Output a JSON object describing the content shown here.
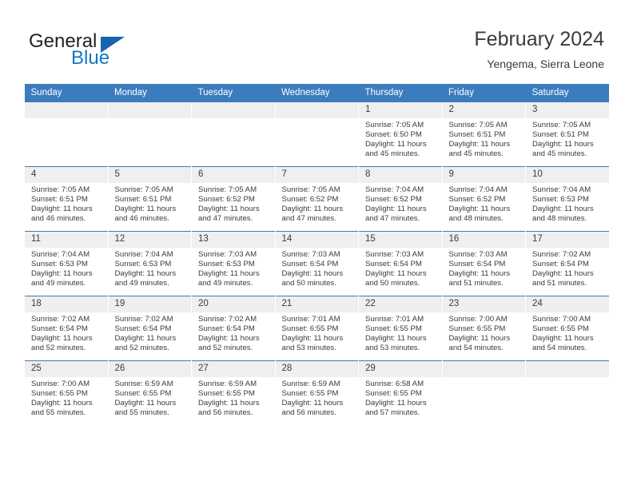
{
  "brand": {
    "name_part1": "General",
    "name_part2": "Blue",
    "logo_icon": "triangle-flag-icon",
    "accent_color": "#1278be",
    "header_color": "#3b7cbe"
  },
  "header": {
    "title": "February 2024",
    "subtitle": "Yengema, Sierra Leone"
  },
  "weekdays": [
    "Sunday",
    "Monday",
    "Tuesday",
    "Wednesday",
    "Thursday",
    "Friday",
    "Saturday"
  ],
  "weeks": [
    [
      {
        "day": "",
        "sunrise": "",
        "sunset": "",
        "daylight_line1": "",
        "daylight_line2": ""
      },
      {
        "day": "",
        "sunrise": "",
        "sunset": "",
        "daylight_line1": "",
        "daylight_line2": ""
      },
      {
        "day": "",
        "sunrise": "",
        "sunset": "",
        "daylight_line1": "",
        "daylight_line2": ""
      },
      {
        "day": "",
        "sunrise": "",
        "sunset": "",
        "daylight_line1": "",
        "daylight_line2": ""
      },
      {
        "day": "1",
        "sunrise": "Sunrise: 7:05 AM",
        "sunset": "Sunset: 6:50 PM",
        "daylight_line1": "Daylight: 11 hours",
        "daylight_line2": "and 45 minutes."
      },
      {
        "day": "2",
        "sunrise": "Sunrise: 7:05 AM",
        "sunset": "Sunset: 6:51 PM",
        "daylight_line1": "Daylight: 11 hours",
        "daylight_line2": "and 45 minutes."
      },
      {
        "day": "3",
        "sunrise": "Sunrise: 7:05 AM",
        "sunset": "Sunset: 6:51 PM",
        "daylight_line1": "Daylight: 11 hours",
        "daylight_line2": "and 45 minutes."
      }
    ],
    [
      {
        "day": "4",
        "sunrise": "Sunrise: 7:05 AM",
        "sunset": "Sunset: 6:51 PM",
        "daylight_line1": "Daylight: 11 hours",
        "daylight_line2": "and 46 minutes."
      },
      {
        "day": "5",
        "sunrise": "Sunrise: 7:05 AM",
        "sunset": "Sunset: 6:51 PM",
        "daylight_line1": "Daylight: 11 hours",
        "daylight_line2": "and 46 minutes."
      },
      {
        "day": "6",
        "sunrise": "Sunrise: 7:05 AM",
        "sunset": "Sunset: 6:52 PM",
        "daylight_line1": "Daylight: 11 hours",
        "daylight_line2": "and 47 minutes."
      },
      {
        "day": "7",
        "sunrise": "Sunrise: 7:05 AM",
        "sunset": "Sunset: 6:52 PM",
        "daylight_line1": "Daylight: 11 hours",
        "daylight_line2": "and 47 minutes."
      },
      {
        "day": "8",
        "sunrise": "Sunrise: 7:04 AM",
        "sunset": "Sunset: 6:52 PM",
        "daylight_line1": "Daylight: 11 hours",
        "daylight_line2": "and 47 minutes."
      },
      {
        "day": "9",
        "sunrise": "Sunrise: 7:04 AM",
        "sunset": "Sunset: 6:52 PM",
        "daylight_line1": "Daylight: 11 hours",
        "daylight_line2": "and 48 minutes."
      },
      {
        "day": "10",
        "sunrise": "Sunrise: 7:04 AM",
        "sunset": "Sunset: 6:53 PM",
        "daylight_line1": "Daylight: 11 hours",
        "daylight_line2": "and 48 minutes."
      }
    ],
    [
      {
        "day": "11",
        "sunrise": "Sunrise: 7:04 AM",
        "sunset": "Sunset: 6:53 PM",
        "daylight_line1": "Daylight: 11 hours",
        "daylight_line2": "and 49 minutes."
      },
      {
        "day": "12",
        "sunrise": "Sunrise: 7:04 AM",
        "sunset": "Sunset: 6:53 PM",
        "daylight_line1": "Daylight: 11 hours",
        "daylight_line2": "and 49 minutes."
      },
      {
        "day": "13",
        "sunrise": "Sunrise: 7:03 AM",
        "sunset": "Sunset: 6:53 PM",
        "daylight_line1": "Daylight: 11 hours",
        "daylight_line2": "and 49 minutes."
      },
      {
        "day": "14",
        "sunrise": "Sunrise: 7:03 AM",
        "sunset": "Sunset: 6:54 PM",
        "daylight_line1": "Daylight: 11 hours",
        "daylight_line2": "and 50 minutes."
      },
      {
        "day": "15",
        "sunrise": "Sunrise: 7:03 AM",
        "sunset": "Sunset: 6:54 PM",
        "daylight_line1": "Daylight: 11 hours",
        "daylight_line2": "and 50 minutes."
      },
      {
        "day": "16",
        "sunrise": "Sunrise: 7:03 AM",
        "sunset": "Sunset: 6:54 PM",
        "daylight_line1": "Daylight: 11 hours",
        "daylight_line2": "and 51 minutes."
      },
      {
        "day": "17",
        "sunrise": "Sunrise: 7:02 AM",
        "sunset": "Sunset: 6:54 PM",
        "daylight_line1": "Daylight: 11 hours",
        "daylight_line2": "and 51 minutes."
      }
    ],
    [
      {
        "day": "18",
        "sunrise": "Sunrise: 7:02 AM",
        "sunset": "Sunset: 6:54 PM",
        "daylight_line1": "Daylight: 11 hours",
        "daylight_line2": "and 52 minutes."
      },
      {
        "day": "19",
        "sunrise": "Sunrise: 7:02 AM",
        "sunset": "Sunset: 6:54 PM",
        "daylight_line1": "Daylight: 11 hours",
        "daylight_line2": "and 52 minutes."
      },
      {
        "day": "20",
        "sunrise": "Sunrise: 7:02 AM",
        "sunset": "Sunset: 6:54 PM",
        "daylight_line1": "Daylight: 11 hours",
        "daylight_line2": "and 52 minutes."
      },
      {
        "day": "21",
        "sunrise": "Sunrise: 7:01 AM",
        "sunset": "Sunset: 6:55 PM",
        "daylight_line1": "Daylight: 11 hours",
        "daylight_line2": "and 53 minutes."
      },
      {
        "day": "22",
        "sunrise": "Sunrise: 7:01 AM",
        "sunset": "Sunset: 6:55 PM",
        "daylight_line1": "Daylight: 11 hours",
        "daylight_line2": "and 53 minutes."
      },
      {
        "day": "23",
        "sunrise": "Sunrise: 7:00 AM",
        "sunset": "Sunset: 6:55 PM",
        "daylight_line1": "Daylight: 11 hours",
        "daylight_line2": "and 54 minutes."
      },
      {
        "day": "24",
        "sunrise": "Sunrise: 7:00 AM",
        "sunset": "Sunset: 6:55 PM",
        "daylight_line1": "Daylight: 11 hours",
        "daylight_line2": "and 54 minutes."
      }
    ],
    [
      {
        "day": "25",
        "sunrise": "Sunrise: 7:00 AM",
        "sunset": "Sunset: 6:55 PM",
        "daylight_line1": "Daylight: 11 hours",
        "daylight_line2": "and 55 minutes."
      },
      {
        "day": "26",
        "sunrise": "Sunrise: 6:59 AM",
        "sunset": "Sunset: 6:55 PM",
        "daylight_line1": "Daylight: 11 hours",
        "daylight_line2": "and 55 minutes."
      },
      {
        "day": "27",
        "sunrise": "Sunrise: 6:59 AM",
        "sunset": "Sunset: 6:55 PM",
        "daylight_line1": "Daylight: 11 hours",
        "daylight_line2": "and 56 minutes."
      },
      {
        "day": "28",
        "sunrise": "Sunrise: 6:59 AM",
        "sunset": "Sunset: 6:55 PM",
        "daylight_line1": "Daylight: 11 hours",
        "daylight_line2": "and 56 minutes."
      },
      {
        "day": "29",
        "sunrise": "Sunrise: 6:58 AM",
        "sunset": "Sunset: 6:55 PM",
        "daylight_line1": "Daylight: 11 hours",
        "daylight_line2": "and 57 minutes."
      },
      {
        "day": "",
        "sunrise": "",
        "sunset": "",
        "daylight_line1": "",
        "daylight_line2": ""
      },
      {
        "day": "",
        "sunrise": "",
        "sunset": "",
        "daylight_line1": "",
        "daylight_line2": ""
      }
    ]
  ]
}
